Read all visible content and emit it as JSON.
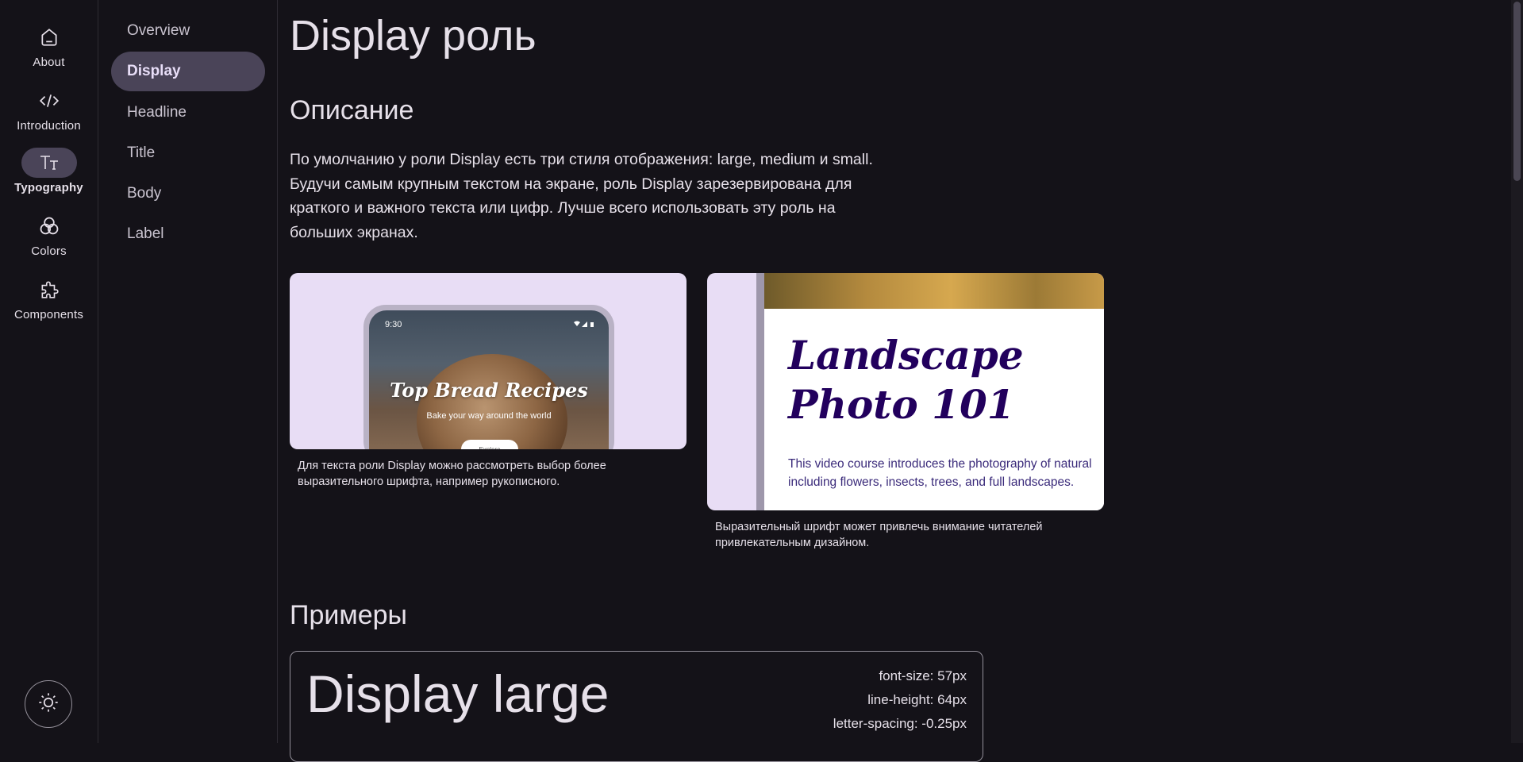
{
  "rail": {
    "items": [
      {
        "label": "About",
        "icon": "home-icon",
        "active": false
      },
      {
        "label": "Introduction",
        "icon": "code-icon",
        "active": false
      },
      {
        "label": "Typography",
        "icon": "text-fields-icon",
        "active": true
      },
      {
        "label": "Colors",
        "icon": "palette-circles-icon",
        "active": false
      },
      {
        "label": "Components",
        "icon": "puzzle-icon",
        "active": false
      }
    ],
    "theme_toggle_icon": "sun-icon"
  },
  "sidenav": {
    "items": [
      "Overview",
      "Display",
      "Headline",
      "Title",
      "Body",
      "Label"
    ],
    "active": "Display"
  },
  "main": {
    "title": "Display роль",
    "description_heading": "Описание",
    "description": "По умолчанию у роли Display есть три стиля отображения: large, medium и small. Будучи самым крупным текстом на экране, роль Display зарезервирована для краткого и важного текста или цифр. Лучше всего использовать эту роль на больших экранах.",
    "card1": {
      "status_time": "9:30",
      "title": "Top Bread Recipes",
      "subtitle": "Bake your way around the world",
      "pill": "Explore",
      "caption": "Для текста роли Display можно рассмотреть выбор более выразительного шрифта, например рукописного."
    },
    "card2": {
      "title": "Landscape Photo 101",
      "text_line1": "This video course introduces the photography of natural",
      "text_line2": "including flowers, insects, trees, and full landscapes.",
      "caption": "Выразительный шрифт может привлечь внимание читателей привлекательным дизайном."
    },
    "examples_heading": "Примеры",
    "example": {
      "sample": "Display large",
      "font_size": "font-size: 57px",
      "line_height": "line-height: 64px",
      "letter_spacing": "letter-spacing: -0.25px"
    }
  },
  "colors": {
    "background": "#141218",
    "active_indicator": "#4a4458",
    "text": "#e6e0e9",
    "card_bg": "#e8ddf5",
    "landscape_title": "#22005d"
  }
}
